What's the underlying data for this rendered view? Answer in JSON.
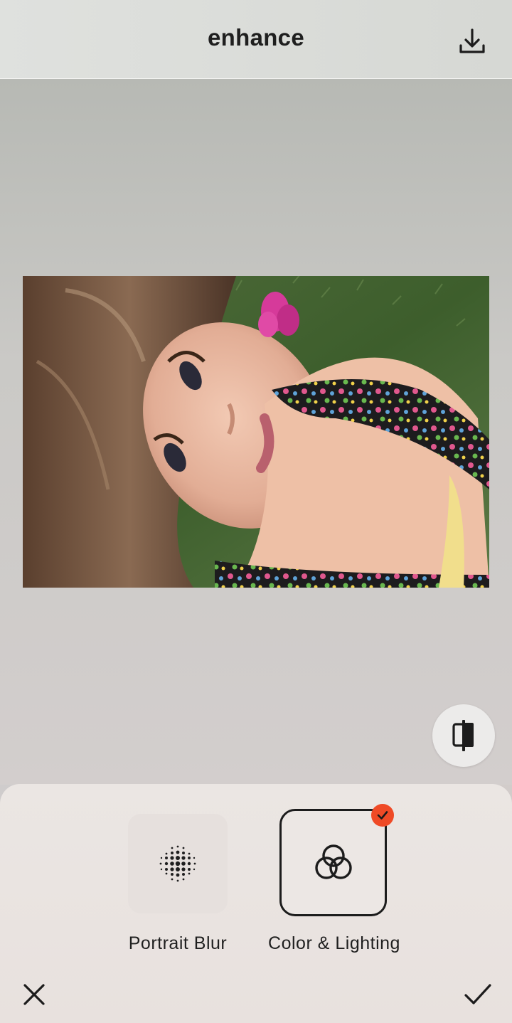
{
  "header": {
    "title": "enhance",
    "download_icon": "download-icon"
  },
  "preview": {
    "image_description_icon": "portrait-photo",
    "compare_icon": "compare-split-icon"
  },
  "tools": [
    {
      "label": "Portrait Blur",
      "icon": "dotted-sphere-icon",
      "selected": false
    },
    {
      "label": "Color & Lighting",
      "icon": "interlinked-circles-icon",
      "selected": true
    }
  ],
  "footer": {
    "close_icon": "close-icon",
    "confirm_icon": "checkmark-icon"
  },
  "colors": {
    "accent_badge": "#ef4a26",
    "text": "#1f1f1f",
    "selected_border": "#1c1c1c"
  }
}
